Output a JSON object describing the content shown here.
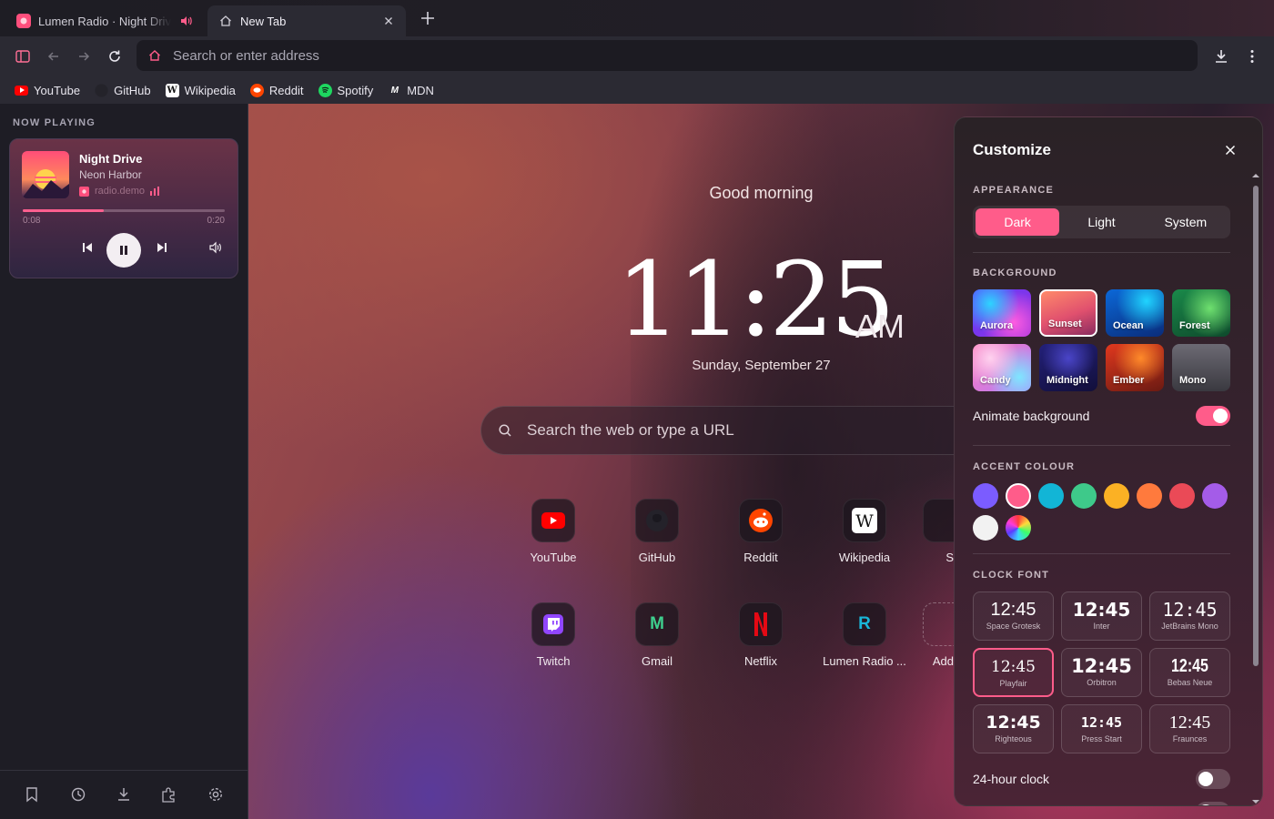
{
  "tabs": [
    {
      "title": "Lumen Radio · Night Drive",
      "audio": true
    },
    {
      "title": "New Tab"
    }
  ],
  "navbar": {
    "url_placeholder": "Search or enter address"
  },
  "bookmarks": [
    "YouTube",
    "GitHub",
    "Wikipedia",
    "Reddit",
    "Spotify",
    "MDN"
  ],
  "sidebar": {
    "title": "NOW PLAYING",
    "player": {
      "track": "Night Drive",
      "artist": "Neon Harbor",
      "source": "radio.demo",
      "elapsed": "0:08",
      "duration": "0:20",
      "progress": 0.4
    }
  },
  "newtab": {
    "greeting": "Good morning",
    "time": "11:25",
    "ampm": "AM",
    "date": "Sunday, September 27",
    "search_placeholder": "Search the web or type a URL",
    "shortcuts_row1": [
      "YouTube",
      "GitHub",
      "Reddit",
      "Wikipedia",
      "S"
    ],
    "shortcuts_row2": [
      "Twitch",
      "Gmail",
      "Netflix",
      "Lumen Radio ...",
      "Add"
    ]
  },
  "customize": {
    "title": "Customize",
    "appearance_label": "APPEARANCE",
    "modes": [
      "Dark",
      "Light",
      "System"
    ],
    "selected_mode": "Dark",
    "background_label": "BACKGROUND",
    "backgrounds": [
      "Aurora",
      "Sunset",
      "Ocean",
      "Forest",
      "Candy",
      "Midnight",
      "Ember",
      "Mono"
    ],
    "selected_background": "Sunset",
    "animate_label": "Animate background",
    "animate_on": true,
    "accent_label": "ACCENT COLOUR",
    "accent_colors": [
      "#7b5cff",
      "#ff5c8a",
      "#12b5d6",
      "#3ec98a",
      "#fbb124",
      "#ff7a3d",
      "#ea4a57",
      "#a45ce8",
      "#f2f2f2",
      "rainbow"
    ],
    "selected_accent": "#ff5c8a",
    "clock_font_label": "CLOCK FONT",
    "fonts": [
      {
        "sample": "12:45",
        "name": "Space Grotesk"
      },
      {
        "sample": "12:45",
        "name": "Inter"
      },
      {
        "sample": "12:45",
        "name": "JetBrains Mono"
      },
      {
        "sample": "12:45",
        "name": "Playfair"
      },
      {
        "sample": "12:45",
        "name": "Orbitron"
      },
      {
        "sample": "12:45",
        "name": "Bebas Neue"
      },
      {
        "sample": "12:45",
        "name": "Righteous"
      },
      {
        "sample": "12:45",
        "name": "Press Start"
      },
      {
        "sample": "12:45",
        "name": "Fraunces"
      }
    ],
    "selected_font": "Playfair",
    "h24_label": "24-hour clock",
    "h24_on": false
  },
  "colors": {
    "accent": "#ff5c8a",
    "chrome": "#2b2a33"
  }
}
